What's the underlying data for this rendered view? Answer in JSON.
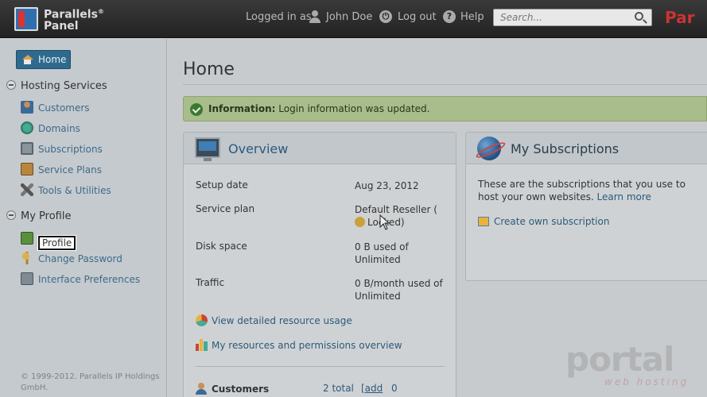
{
  "header": {
    "brand_line1": "Parallels",
    "brand_reg": "®",
    "brand_line2": "Panel",
    "logged_in_as": "Logged in as",
    "user_name": "John Doe",
    "logout": "Log out",
    "help": "Help",
    "search_placeholder": "Search...",
    "brand_right": "Par"
  },
  "sidebar": {
    "home": "Home",
    "hosting_services": "Hosting Services",
    "hosting_items": [
      "Customers",
      "Domains",
      "Subscriptions",
      "Service Plans",
      "Tools & Utilities"
    ],
    "my_profile": "My Profile",
    "profile_items": [
      "Profile",
      "Change Password",
      "Interface Preferences"
    ],
    "copyright": "© 1999-2012. Parallels IP Holdings GmbH."
  },
  "main": {
    "title": "Home",
    "info_label": "Information:",
    "info_text": "Login information was updated.",
    "overview": {
      "title": "Overview",
      "rows": [
        {
          "label": "Setup date",
          "value": "Aug 23, 2012"
        },
        {
          "label": "Service plan",
          "value": "Default Reseller (",
          "value2": "Locked)"
        },
        {
          "label": "Disk space",
          "value": "0 B used of Unlimited"
        },
        {
          "label": "Traffic",
          "value": "0 B/month used of Unlimited"
        }
      ],
      "link_usage": "View detailed resource usage",
      "link_permissions": "My resources and permissions overview",
      "customers_label": "Customers",
      "customers_total": "2 total",
      "customers_add": "[add",
      "customers_zero": "0"
    },
    "subscriptions": {
      "title": "My Subscriptions",
      "text": "These are the subscriptions that you use to host your own websites.",
      "learn_more": "Learn more",
      "create": "Create own subscription"
    }
  },
  "watermark": {
    "text": "portal",
    "sub": "web hosting"
  }
}
